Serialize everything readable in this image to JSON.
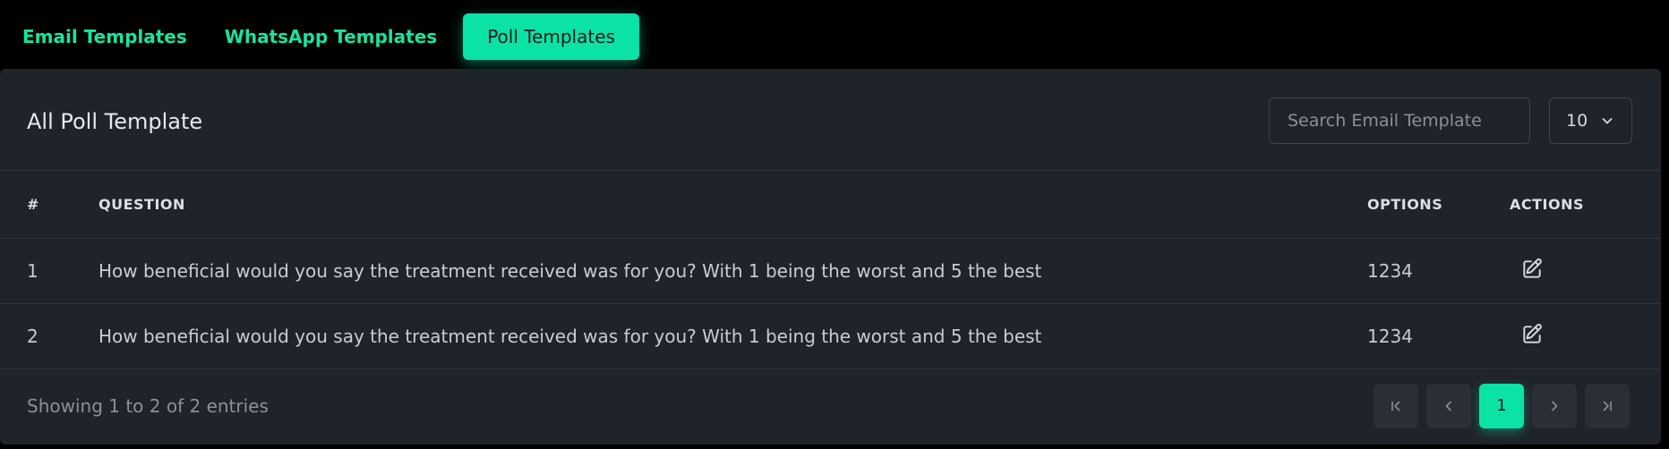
{
  "tabs": [
    {
      "label": "Email Templates",
      "active": false
    },
    {
      "label": "WhatsApp Templates",
      "active": false
    },
    {
      "label": "Poll Templates",
      "active": true
    }
  ],
  "card": {
    "title": "All Poll Template",
    "search": {
      "placeholder": "Search Email Template",
      "value": ""
    },
    "page_size": {
      "value": "10",
      "icon": "chevron-down-icon"
    }
  },
  "table": {
    "headers": {
      "num": "#",
      "question": "QUESTION",
      "options": "OPTIONS",
      "actions": "ACTIONS"
    },
    "rows": [
      {
        "num": "1",
        "question": "How beneficial would you say the treatment received was for you? With 1 being the worst and 5 the best",
        "options": "1234",
        "action_icon": "edit-icon"
      },
      {
        "num": "2",
        "question": "How beneficial would you say the treatment received was for you? With 1 being the worst and 5 the best",
        "options": "1234",
        "action_icon": "edit-icon"
      }
    ]
  },
  "footer": {
    "entries_info": "Showing 1 to 2 of 2 entries",
    "pagination": {
      "first_icon": "first-page-icon",
      "prev_icon": "chevron-left-icon",
      "current_page": "1",
      "next_icon": "chevron-right-icon",
      "last_icon": "last-page-icon"
    }
  },
  "colors": {
    "accent": "#0be3a6",
    "card_bg": "#1f232a",
    "page_bg": "#000000"
  }
}
